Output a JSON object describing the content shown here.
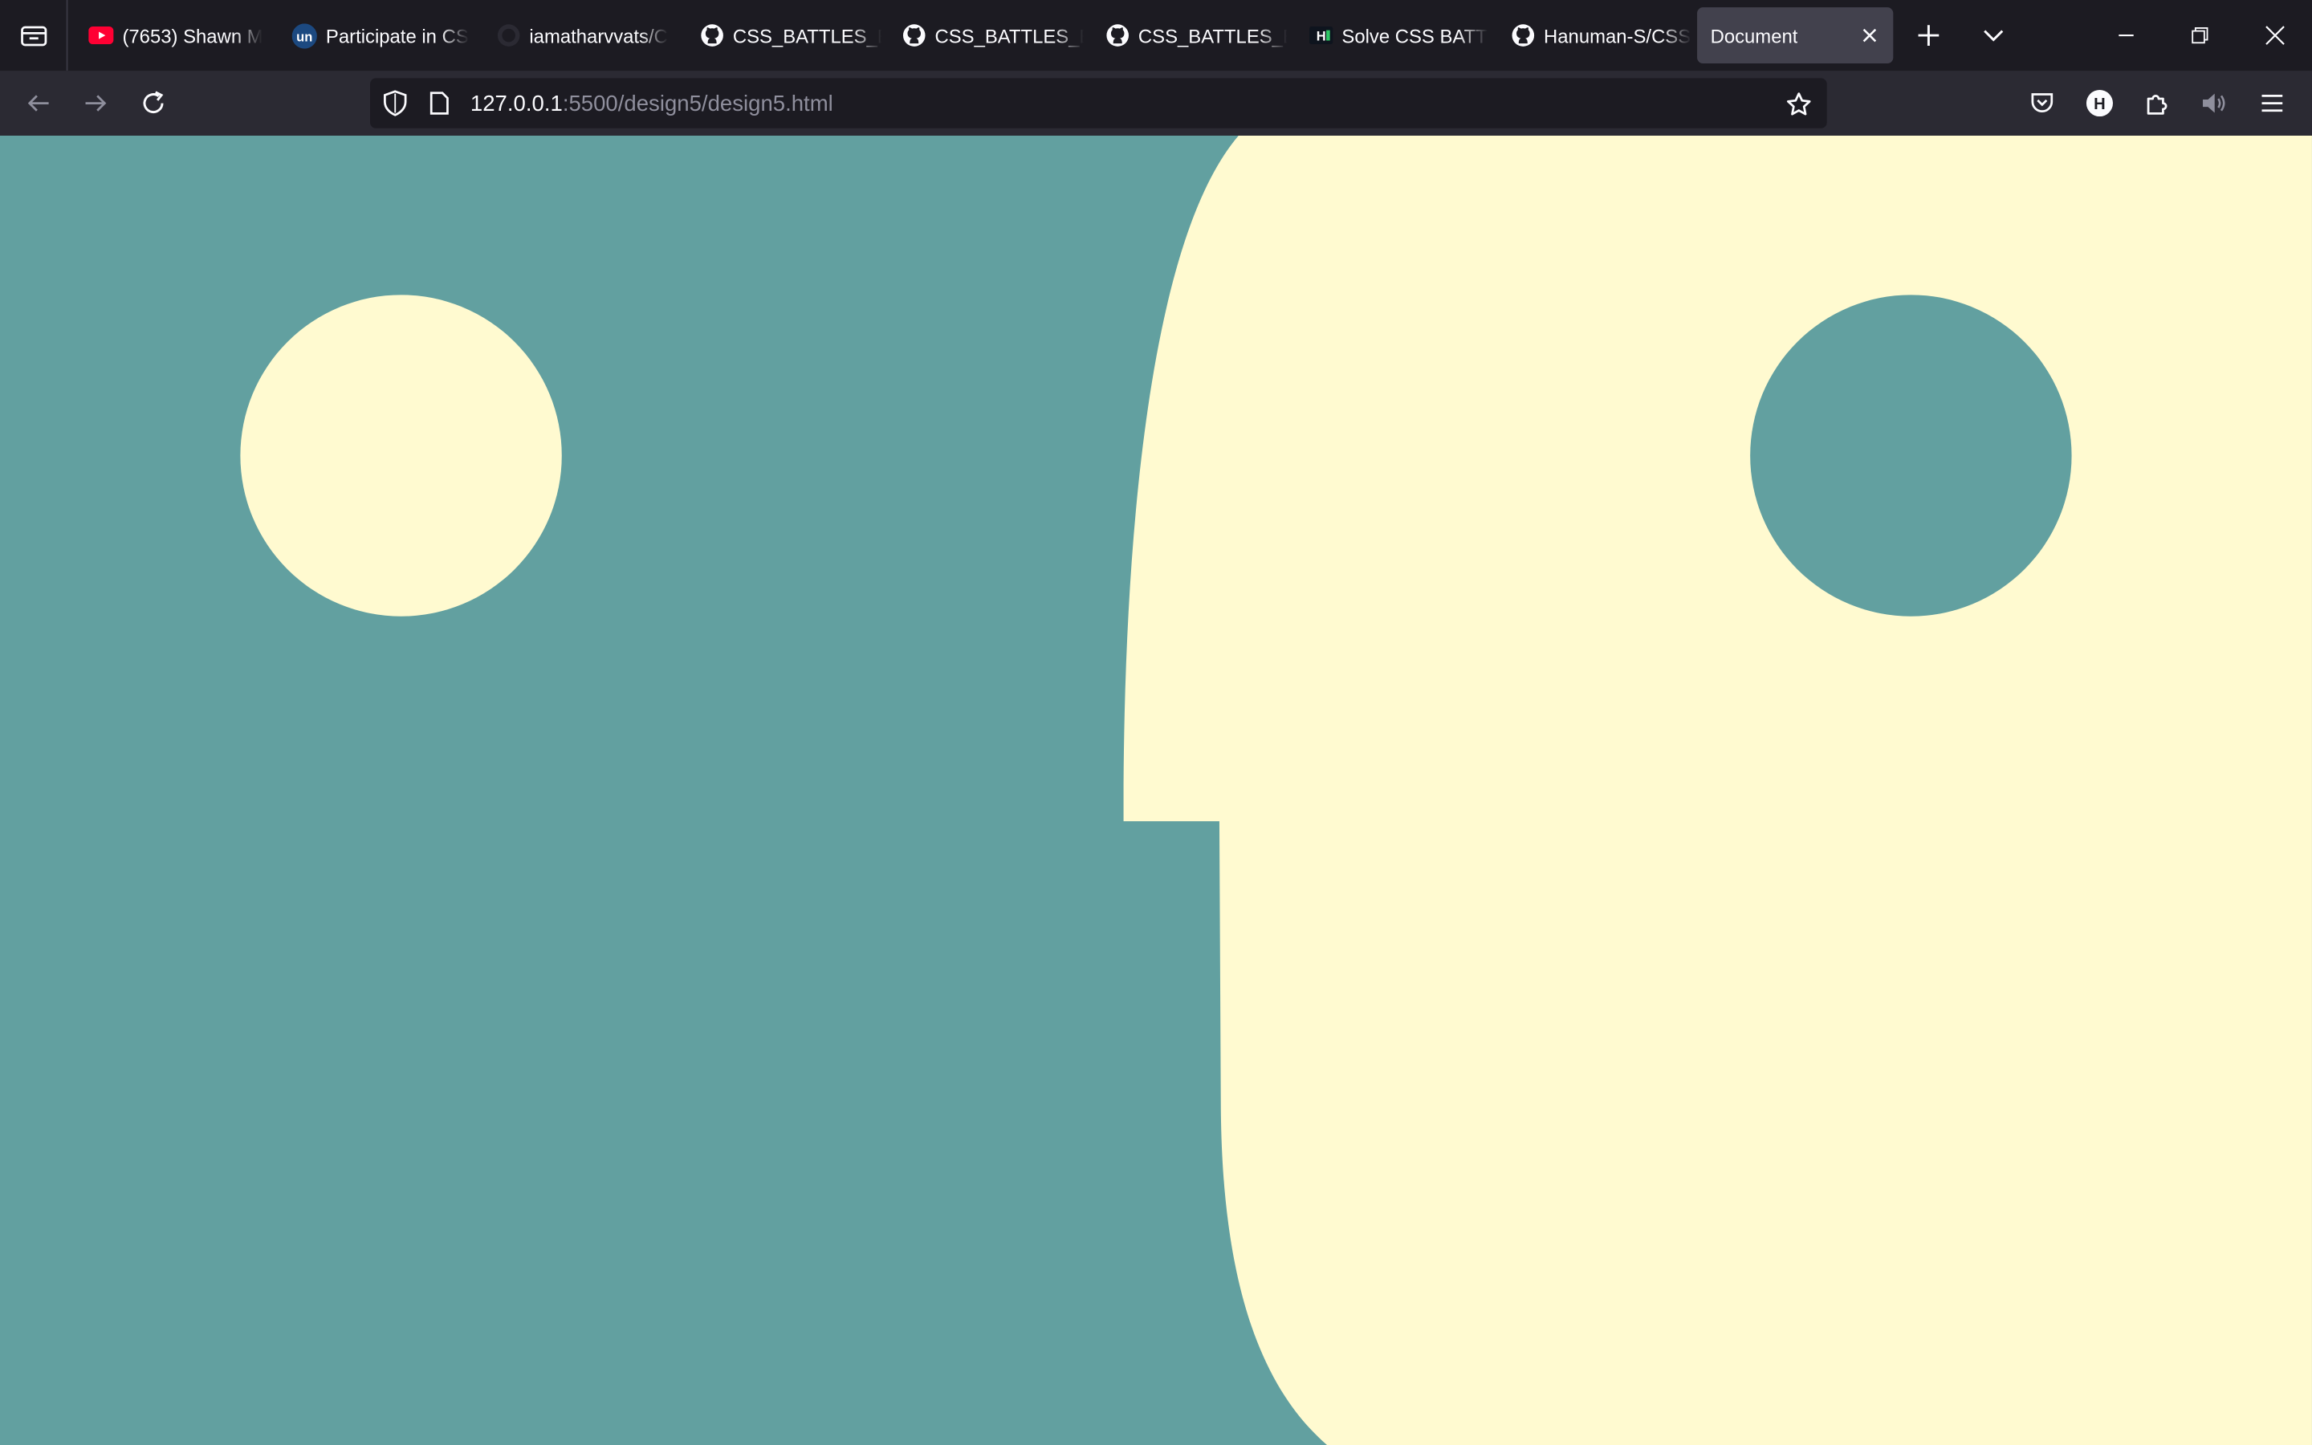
{
  "tabs": [
    {
      "label": "(7653) Shawn M",
      "icon": "youtube-icon"
    },
    {
      "label": "Participate in CS",
      "icon": "unstop-icon"
    },
    {
      "label": "iamatharvvats/C",
      "icon": "github-icon"
    },
    {
      "label": "CSS_BATTLES_B",
      "icon": "github-icon"
    },
    {
      "label": "CSS_BATTLES_B",
      "icon": "github-icon"
    },
    {
      "label": "CSS_BATTLES_B",
      "icon": "github-icon"
    },
    {
      "label": "Solve CSS BATT",
      "icon": "hackerrank-icon"
    },
    {
      "label": "Hanuman-S/CSS",
      "icon": "github-icon"
    },
    {
      "label": "Document",
      "icon": "none",
      "active": true
    }
  ],
  "address": {
    "host": "127.0.0.1",
    "path": ":5500/design5/design5.html"
  },
  "colors": {
    "teal": "#62a0a0",
    "cream": "#fffad0",
    "chrome_dark": "#1c1b22",
    "chrome": "#2b2a33",
    "active_tab": "#42414d",
    "youtube_red": "#ff0033",
    "unstop_blue": "#1c4980"
  }
}
